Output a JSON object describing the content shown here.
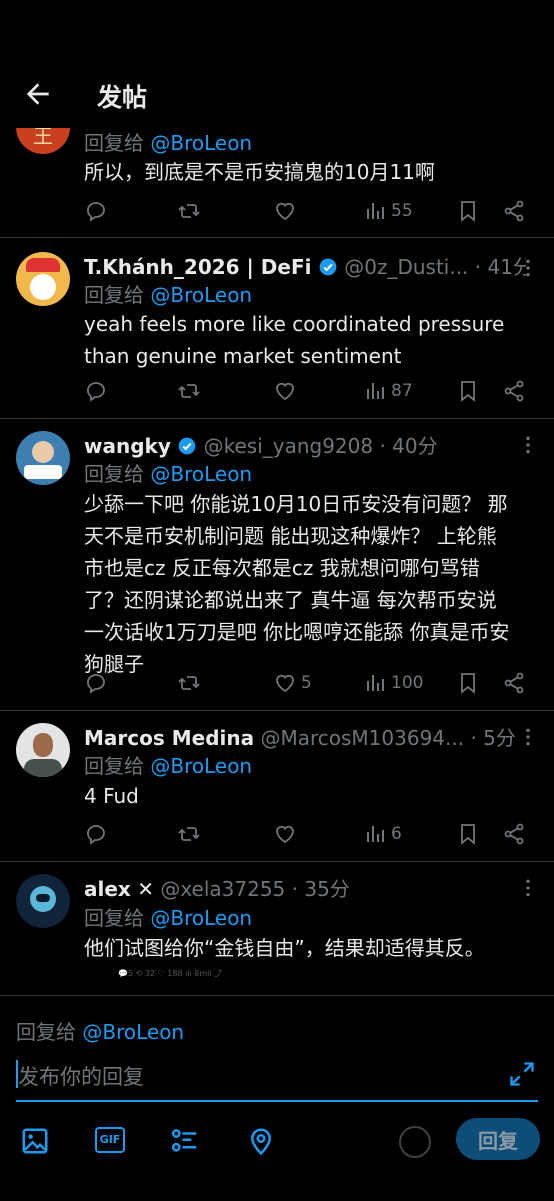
{
  "header": {
    "title": "发帖"
  },
  "tweets": [
    {
      "reply_prefix": "回复给",
      "reply_handle": "@BroLeon",
      "text": "所以，到底是不是币安搞鬼的10月11啊",
      "stats": {
        "replies": "",
        "retweets": "",
        "likes": "",
        "views": "55"
      }
    },
    {
      "name": "T.Khánh_2026 | DeFi",
      "handle": "@0z_Dusti...",
      "time": "· 41分",
      "reply_prefix": "回复给",
      "reply_handle": "@BroLeon",
      "text_lines": [
        "yeah feels more like coordinated pressure",
        "than genuine market sentiment"
      ],
      "stats": {
        "replies": "",
        "retweets": "",
        "likes": "",
        "views": "87"
      }
    },
    {
      "name": "wangky",
      "handle": "@kesi_yang9208",
      "time": "· 40分",
      "reply_prefix": "回复给",
      "reply_handle": "@BroLeon",
      "text_lines": [
        "少舔一下吧 你能说10月10日币安没有问题？ 那",
        "天不是币安机制问题 能出现这种爆炸？ 上轮熊",
        "市也是cz 反正每次都是cz 我就想问哪句骂错",
        "了？还阴谋论都说出来了 真牛逼 每次帮币安说",
        "一次话收1万刀是吧 你比嗯哼还能舔 你真是币安",
        "狗腿子"
      ],
      "stats": {
        "replies": "",
        "retweets": "",
        "likes": "5",
        "views": "100"
      }
    },
    {
      "name": "Marcos Medina",
      "handle": "@MarcosM103694...",
      "time": "· 5分",
      "reply_prefix": "回复给",
      "reply_handle": "@BroLeon",
      "text": "4 Fud",
      "stats": {
        "replies": "",
        "retweets": "",
        "likes": "",
        "views": "6"
      }
    },
    {
      "name": "alex",
      "badge": "✕",
      "handle": "@xela37255",
      "time": "· 35分",
      "reply_prefix": "回复给",
      "reply_handle": "@BroLeon",
      "text": "他们试图给你“金钱自由”，结果却适得其反。",
      "mini_stats": "💬5    ⟲ 32    ♡ 188    ılı 8mil    ⤴"
    }
  ],
  "composer": {
    "reply_prefix": "回复给",
    "reply_handle": "@BroLeon",
    "placeholder": "发布你的回复",
    "gif_label": "GIF",
    "reply_button": "回复"
  },
  "colors": {
    "accent": "#1d9bf0",
    "muted": "#71767b",
    "background": "#000000",
    "divider": "#2f3336"
  }
}
